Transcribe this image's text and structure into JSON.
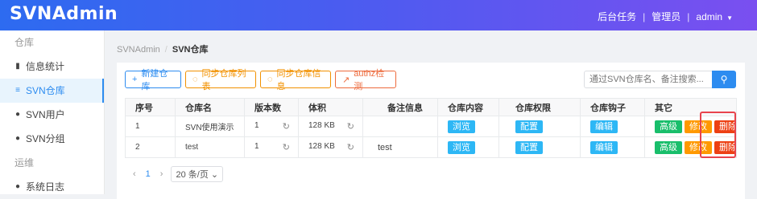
{
  "header": {
    "logo": "SVNAdmin",
    "tasks": "后台任务",
    "sep1": "|",
    "admin_link": "管理员",
    "sep2": "|",
    "user": "admin"
  },
  "sidebar": {
    "group1": "仓库",
    "items": [
      {
        "label": "信息统计",
        "icon": "bar-chart-icon",
        "glyph": "▮"
      },
      {
        "label": "SVN仓库",
        "icon": "database-icon",
        "glyph": "≡"
      },
      {
        "label": "SVN用户",
        "icon": "user-icon",
        "glyph": "●"
      },
      {
        "label": "SVN分组",
        "icon": "users-icon",
        "glyph": "●"
      }
    ],
    "group2": "运维",
    "partial_item": {
      "label": "系统日志",
      "icon": "log-icon",
      "glyph": "●"
    }
  },
  "breadcrumb": {
    "root": "SVNAdmin",
    "sep": "/",
    "current": "SVN仓库"
  },
  "toolbar": {
    "new_repo": "新建仓库",
    "new_repo_glyph": "+",
    "sync_list": "同步仓库列表",
    "sync_list_glyph": "◌",
    "sync_info": "同步仓库信息",
    "sync_info_glyph": "◌",
    "authz": "authz检测",
    "authz_glyph": "↗",
    "search_placeholder": "通过SVN仓库名、备注搜索...",
    "search_glyph": "⚲"
  },
  "table": {
    "headers": [
      "序号",
      "仓库名",
      "版本数",
      "体积",
      "备注信息",
      "仓库内容",
      "仓库权限",
      "仓库钩子",
      "其它"
    ],
    "refresh_glyph": "↻",
    "rows": [
      {
        "no": "1",
        "name": "SVN使用演示",
        "rev": "1",
        "size": "128 KB",
        "note": "",
        "browse": "浏览",
        "perm": "配置",
        "hook": "编辑",
        "adv": "高级",
        "edit": "修改",
        "del": "删除"
      },
      {
        "no": "2",
        "name": "test",
        "rev": "1",
        "size": "128 KB",
        "note": "test",
        "browse": "浏览",
        "perm": "配置",
        "hook": "编辑",
        "adv": "高级",
        "edit": "修改",
        "del": "删除"
      }
    ]
  },
  "pager": {
    "prev": "‹",
    "page": "1",
    "next": "›",
    "size": "20 条/页",
    "size_caret": "⌄"
  },
  "colors": {
    "primary": "#2d8cf0",
    "info": "#2db7f5",
    "success": "#19be6b",
    "warning": "#ff9900",
    "error": "#ed4014",
    "orange": "#f29100",
    "authz": "#ed6a3c"
  }
}
